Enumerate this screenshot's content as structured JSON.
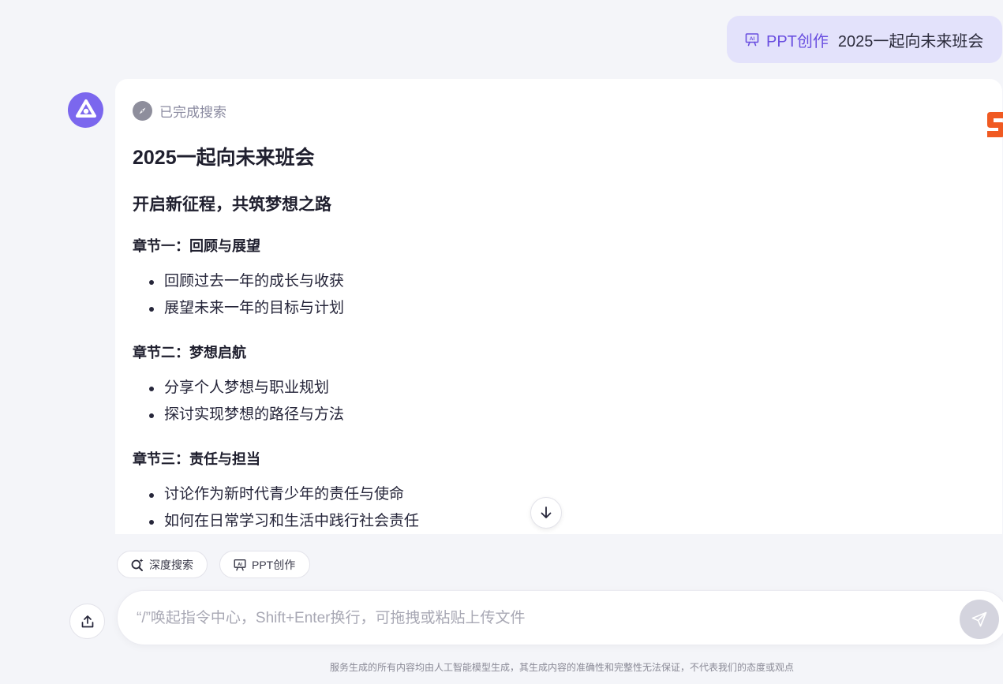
{
  "user_message": {
    "tag_label": "PPT创作",
    "tag_icon": "presentation-icon",
    "query": "2025一起向未来班会"
  },
  "assistant": {
    "avatar_icon": "assistant-logo-icon",
    "search_status": "已完成搜索",
    "title": "2025一起向未来班会",
    "subtitle": "开启新征程，共筑梦想之路",
    "sections": [
      {
        "heading": "章节一：回顾与展望",
        "items": [
          "回顾过去一年的成长与收获",
          "展望未来一年的目标与计划"
        ]
      },
      {
        "heading": "章节二：梦想启航",
        "items": [
          "分享个人梦想与职业规划",
          "探讨实现梦想的路径与方法"
        ]
      },
      {
        "heading": "章节三：责任与担当",
        "items": [
          "讨论作为新时代青少年的责任与使命",
          "如何在日常学习和生活中践行社会责任"
        ]
      }
    ]
  },
  "tools": {
    "deep_search_label": "深度搜索",
    "ppt_label": "PPT创作"
  },
  "input": {
    "placeholder": "“/”唤起指令中心，Shift+Enter换行，可拖拽或粘贴上传文件"
  },
  "disclaimer": "服务生成的所有内容均由人工智能模型生成，其生成内容的准确性和完整性无法保证，不代表我们的态度或观点",
  "colors": {
    "accent": "#6a4fe0",
    "bubble_bg": "#e3e2fb",
    "avatar_bg": "#7b67ee",
    "page_bg": "#f4f5f9",
    "send_disabled": "#d4d4de"
  }
}
